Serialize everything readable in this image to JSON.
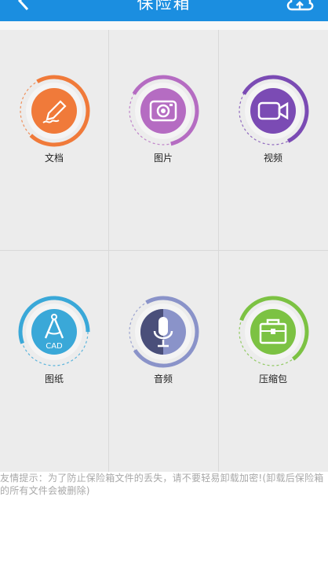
{
  "header": {
    "title": "保险箱"
  },
  "grid": {
    "items": [
      {
        "label": "文档",
        "color": "#f07a3a",
        "icon": "pencil-icon"
      },
      {
        "label": "图片",
        "color": "#b56cc2",
        "icon": "camera-icon"
      },
      {
        "label": "视频",
        "color": "#7b4bb4",
        "icon": "video-camera-icon"
      },
      {
        "label": "图纸",
        "color": "#3aa8d8",
        "icon": "cad-compass-icon"
      },
      {
        "label": "音频",
        "color": "#8a93c9",
        "icon": "microphone-icon"
      },
      {
        "label": "压缩包",
        "color": "#7cc243",
        "icon": "briefcase-icon"
      }
    ]
  },
  "footer": {
    "tip": "友情提示：为了防止保险箱文件的丢失，请不要轻易卸载加密!(卸载后保险箱的所有文件会被删除)"
  }
}
